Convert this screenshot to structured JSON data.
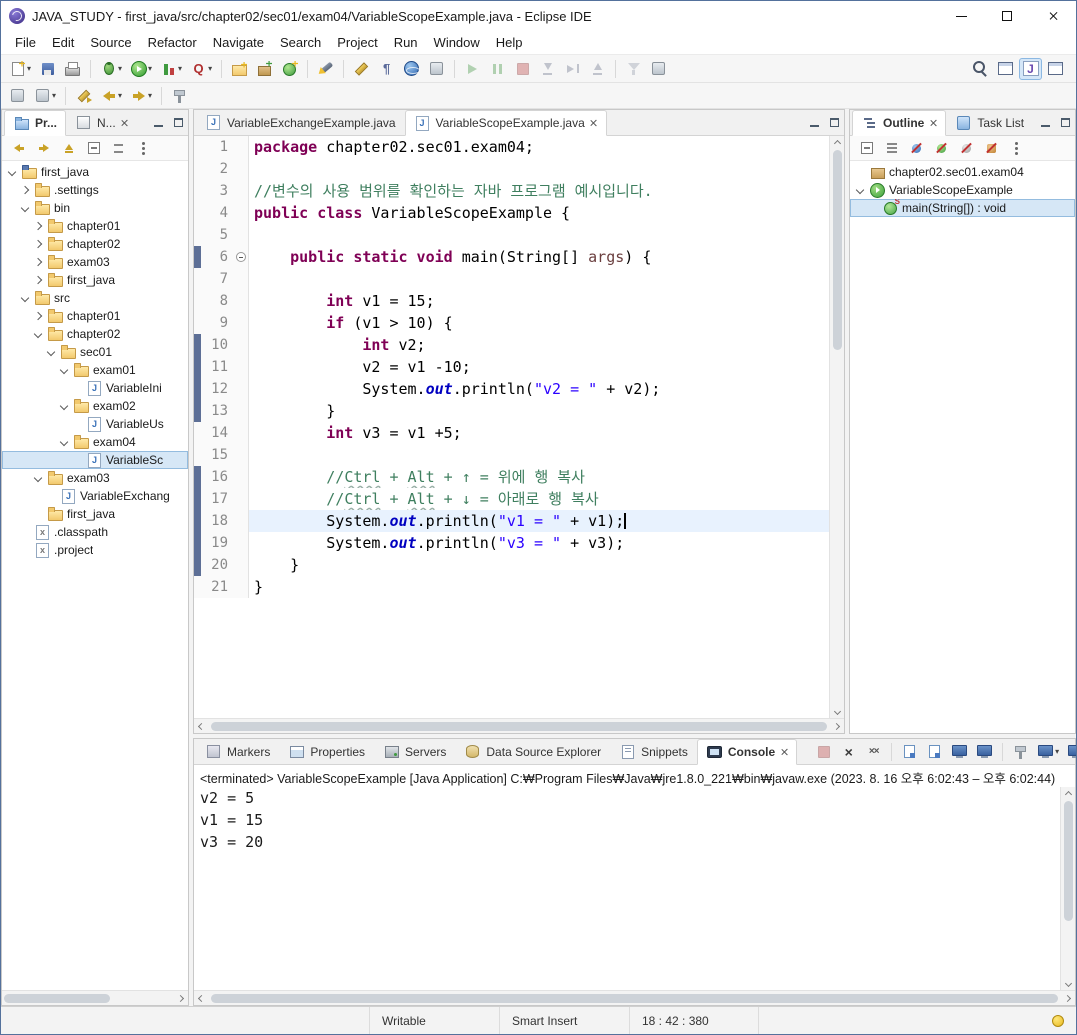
{
  "window": {
    "title": "JAVA_STUDY - first_java/src/chapter02/sec01/exam04/VariableScopeExample.java - Eclipse IDE"
  },
  "menubar": {
    "items": [
      "File",
      "Edit",
      "Source",
      "Refactor",
      "Navigate",
      "Search",
      "Project",
      "Run",
      "Window",
      "Help"
    ]
  },
  "toolbar": {
    "main": [
      {
        "name": "new-wizard",
        "icon": "new",
        "dd": true
      },
      {
        "name": "save",
        "icon": "save"
      },
      {
        "name": "print",
        "icon": "print"
      },
      {
        "sep": true
      },
      {
        "name": "debug",
        "icon": "debug",
        "dd": true
      },
      {
        "name": "run",
        "icon": "run",
        "dd": true
      },
      {
        "name": "coverage",
        "icon": "coverage",
        "dd": true
      },
      {
        "name": "external-tools",
        "icon": "qtool",
        "dd": true
      },
      {
        "sep": true
      },
      {
        "name": "new-java-project",
        "icon": "newprj"
      },
      {
        "name": "new-java-package",
        "icon": "newpkg"
      },
      {
        "name": "new-java-class",
        "icon": "newcls"
      },
      {
        "sep": true
      },
      {
        "name": "search",
        "icon": "flashlight"
      },
      {
        "sep": true
      },
      {
        "name": "mark-occurrences",
        "icon": "pencil"
      },
      {
        "name": "show-whitespace",
        "icon": "para"
      },
      {
        "name": "open-web-browser",
        "icon": "globe"
      },
      {
        "name": "open-task",
        "icon": "gen"
      },
      {
        "sep": true
      },
      {
        "name": "resume",
        "icon": "resume",
        "disabled": true
      },
      {
        "name": "suspend",
        "icon": "suspend",
        "disabled": true
      },
      {
        "name": "terminate",
        "icon": "terminate",
        "disabled": true
      },
      {
        "name": "step-into",
        "icon": "stepin",
        "disabled": true
      },
      {
        "name": "step-over",
        "icon": "stepover",
        "disabled": true
      },
      {
        "name": "step-return",
        "icon": "stepret",
        "disabled": true
      },
      {
        "sep": true
      },
      {
        "name": "use-step-filters",
        "icon": "filter",
        "disabled": true
      },
      {
        "name": "run-configurations",
        "icon": "gen"
      }
    ],
    "right": [
      {
        "name": "quick-access-search",
        "icon": "magnifier"
      },
      {
        "name": "open-perspective",
        "icon": "perspective"
      },
      {
        "name": "java-perspective",
        "icon": "javapersp",
        "active": true
      },
      {
        "name": "debug-perspective",
        "icon": "perspective"
      }
    ],
    "second": [
      {
        "name": "toggle-breadcrumb",
        "icon": "gen"
      },
      {
        "name": "annotations",
        "icon": "gen",
        "dd": true
      },
      {
        "sep": true
      },
      {
        "name": "last-edit-location",
        "icon": "lastedit"
      },
      {
        "name": "back-history",
        "icon": "backarrow",
        "dd": true
      },
      {
        "name": "forward-history",
        "icon": "fwdarrow",
        "dd": true
      },
      {
        "sep": true
      },
      {
        "name": "pin-editor",
        "icon": "pin"
      }
    ]
  },
  "explorer": {
    "tabs": [
      {
        "label": "Pr...",
        "icon": "prexp",
        "active": true
      },
      {
        "label": "N...",
        "icon": "nav",
        "close": true
      }
    ],
    "toolbar": [
      {
        "name": "back",
        "icon": "backsm"
      },
      {
        "name": "forward",
        "icon": "fwdsm"
      },
      {
        "name": "up",
        "icon": "upsm"
      },
      {
        "name": "collapse-all",
        "icon": "collapse"
      },
      {
        "name": "link-with-editor",
        "icon": "link"
      },
      {
        "name": "view-menu",
        "icon": "dots"
      }
    ],
    "tree": [
      {
        "label": "first_java",
        "level": 0,
        "icon": "project",
        "arrow": "v"
      },
      {
        "label": ".settings",
        "level": 1,
        "icon": "folder",
        "arrow": ">"
      },
      {
        "label": "bin",
        "level": 1,
        "icon": "folder",
        "arrow": "v"
      },
      {
        "label": "chapter01",
        "level": 2,
        "icon": "folder",
        "arrow": ">"
      },
      {
        "label": "chapter02",
        "level": 2,
        "icon": "folder",
        "arrow": ">"
      },
      {
        "label": "exam03",
        "level": 2,
        "icon": "folder",
        "arrow": ">"
      },
      {
        "label": "first_java",
        "level": 2,
        "icon": "folder",
        "arrow": ">"
      },
      {
        "label": "src",
        "level": 1,
        "icon": "folder",
        "arrow": "v"
      },
      {
        "label": "chapter01",
        "level": 2,
        "icon": "folder",
        "arrow": ">"
      },
      {
        "label": "chapter02",
        "level": 2,
        "icon": "folder",
        "arrow": "v"
      },
      {
        "label": "sec01",
        "level": 3,
        "icon": "folder",
        "arrow": "v"
      },
      {
        "label": "exam01",
        "level": 4,
        "icon": "folder",
        "arrow": "v"
      },
      {
        "label": "VariableIni",
        "level": 5,
        "icon": "jfile",
        "arrow": ""
      },
      {
        "label": "exam02",
        "level": 4,
        "icon": "folder",
        "arrow": "v"
      },
      {
        "label": "VariableUs",
        "level": 5,
        "icon": "jfile",
        "arrow": ""
      },
      {
        "label": "exam04",
        "level": 4,
        "icon": "folder",
        "arrow": "v"
      },
      {
        "label": "VariableSc",
        "level": 5,
        "icon": "jfile",
        "arrow": "",
        "selected": true
      },
      {
        "label": "exam03",
        "level": 2,
        "icon": "folder",
        "arrow": "v"
      },
      {
        "label": "VariableExchang",
        "level": 3,
        "icon": "jfile",
        "arrow": ""
      },
      {
        "label": "first_java",
        "level": 2,
        "icon": "folder",
        "arrow": ""
      },
      {
        "label": ".classpath",
        "level": 1,
        "icon": "xfile",
        "arrow": ""
      },
      {
        "label": ".project",
        "level": 1,
        "icon": "xfile",
        "arrow": ""
      }
    ]
  },
  "editor": {
    "tabs": [
      {
        "label": "VariableExchangeExample.java",
        "icon": "jfile"
      },
      {
        "label": "VariableScopeExample.java",
        "icon": "jfile",
        "active": true,
        "close": true
      }
    ],
    "current_line": 18,
    "fold_line": 6,
    "change_bars": [
      [
        6,
        6
      ],
      [
        10,
        13
      ],
      [
        16,
        20
      ]
    ],
    "colors": {
      "keyword": "#7f0055",
      "string": "#2a00ff",
      "comment": "#3f7f5f",
      "static_field": "#0000c0",
      "current_line": "#e8f2fe",
      "change_bar": "#5d6f96",
      "selection": "#d6e7f6"
    },
    "lines": [
      {
        "n": 1,
        "segs": [
          [
            "kw",
            "package"
          ],
          [
            "pl",
            " chapter02.sec01.exam04;"
          ]
        ]
      },
      {
        "n": 2
      },
      {
        "n": 3,
        "segs": [
          [
            "com",
            "//변수의 사용 범위를 확인하는 자바 프로그램 예시입니다."
          ]
        ]
      },
      {
        "n": 4,
        "segs": [
          [
            "kw",
            "public class"
          ],
          [
            "pl",
            " VariableScopeExample {"
          ]
        ]
      },
      {
        "n": 5
      },
      {
        "n": 6,
        "segs": [
          [
            "pl",
            "    "
          ],
          [
            "kw",
            "public static void"
          ],
          [
            "pl",
            " main(String[] "
          ],
          [
            "param",
            "args"
          ],
          [
            "pl",
            ") {"
          ]
        ]
      },
      {
        "n": 7
      },
      {
        "n": 8,
        "segs": [
          [
            "pl",
            "        "
          ],
          [
            "kw",
            "int"
          ],
          [
            "pl",
            " v1 = 15;"
          ]
        ]
      },
      {
        "n": 9,
        "segs": [
          [
            "pl",
            "        "
          ],
          [
            "kw",
            "if"
          ],
          [
            "pl",
            " (v1 > 10) {"
          ]
        ]
      },
      {
        "n": 10,
        "segs": [
          [
            "pl",
            "            "
          ],
          [
            "kw",
            "int"
          ],
          [
            "pl",
            " v2;"
          ]
        ]
      },
      {
        "n": 11,
        "segs": [
          [
            "pl",
            "            v2 = v1 -10;"
          ]
        ]
      },
      {
        "n": 12,
        "segs": [
          [
            "pl",
            "            System."
          ],
          [
            "field",
            "out"
          ],
          [
            "pl",
            ".println("
          ],
          [
            "str",
            "\"v2 = \""
          ],
          [
            "pl",
            " + v2);"
          ]
        ]
      },
      {
        "n": 13,
        "segs": [
          [
            "pl",
            "        }"
          ]
        ]
      },
      {
        "n": 14,
        "segs": [
          [
            "pl",
            "        "
          ],
          [
            "kw",
            "int"
          ],
          [
            "pl",
            " v3 = v1 +5;"
          ]
        ]
      },
      {
        "n": 15
      },
      {
        "n": 16,
        "segs": [
          [
            "com",
            "        //"
          ],
          [
            "comu",
            "Ctrl"
          ],
          [
            "com",
            " + "
          ],
          [
            "comu",
            "Alt"
          ],
          [
            "com",
            " + ↑ = 위에 행 복사"
          ]
        ]
      },
      {
        "n": 17,
        "segs": [
          [
            "com",
            "        //"
          ],
          [
            "comu",
            "Ctrl"
          ],
          [
            "com",
            " + "
          ],
          [
            "comu",
            "Alt"
          ],
          [
            "com",
            " + ↓ = 아래로 행 복사"
          ]
        ]
      },
      {
        "n": 18,
        "caret": true,
        "segs": [
          [
            "pl",
            "        System."
          ],
          [
            "field",
            "out"
          ],
          [
            "pl",
            ".println("
          ],
          [
            "str",
            "\"v1 = \""
          ],
          [
            "pl",
            " + v1);"
          ]
        ]
      },
      {
        "n": 19,
        "segs": [
          [
            "pl",
            "        System."
          ],
          [
            "field",
            "out"
          ],
          [
            "pl",
            ".println("
          ],
          [
            "str",
            "\"v3 = \""
          ],
          [
            "pl",
            " + v3);"
          ]
        ]
      },
      {
        "n": 20,
        "segs": [
          [
            "pl",
            "    }"
          ]
        ]
      },
      {
        "n": 21,
        "segs": [
          [
            "pl",
            "}"
          ]
        ]
      }
    ]
  },
  "outline": {
    "tabs": [
      {
        "label": "Outline",
        "icon": "outline",
        "active": true,
        "close": true
      },
      {
        "label": "Task List",
        "icon": "tasklist"
      }
    ],
    "toolbar": [
      {
        "name": "collapse-all",
        "icon": "collapse"
      },
      {
        "name": "sort",
        "icon": "sort"
      },
      {
        "name": "hide-fields",
        "icon": "hidefields"
      },
      {
        "name": "hide-static-members",
        "icon": "hidestatic"
      },
      {
        "name": "hide-non-public-members",
        "icon": "hidenonpublic"
      },
      {
        "name": "hide-local-types",
        "icon": "hidelocal"
      },
      {
        "name": "view-menu",
        "icon": "dots"
      }
    ],
    "tree": [
      {
        "label": "chapter02.sec01.exam04",
        "level": 0,
        "icon": "pkg",
        "arrow": ""
      },
      {
        "label": "VariableScopeExample",
        "level": 0,
        "icon": "classrun",
        "arrow": "v"
      },
      {
        "label": "main(String[]) : void",
        "level": 1,
        "icon": "method",
        "arrow": "",
        "selected": true
      }
    ]
  },
  "console": {
    "tabs": [
      {
        "label": "Markers",
        "icon": "markers"
      },
      {
        "label": "Properties",
        "icon": "properties"
      },
      {
        "label": "Servers",
        "icon": "servers"
      },
      {
        "label": "Data Source Explorer",
        "icon": "dse"
      },
      {
        "label": "Snippets",
        "icon": "snippets"
      },
      {
        "label": "Console",
        "icon": "consoletab",
        "active": true,
        "close": true
      }
    ],
    "actions": [
      {
        "name": "terminate",
        "icon": "terminate",
        "disabled": true
      },
      {
        "name": "remove-launch",
        "icon": "xgray"
      },
      {
        "name": "remove-all-terminated",
        "icon": "xxgray"
      },
      {
        "sep": true
      },
      {
        "name": "clear-console",
        "icon": "bluedoc"
      },
      {
        "name": "scroll-lock",
        "icon": "bluedoc"
      },
      {
        "name": "word-wrap",
        "icon": "bluemon"
      },
      {
        "name": "show-on-output",
        "icon": "bluemon"
      },
      {
        "sep": true
      },
      {
        "name": "pin-console",
        "icon": "pin"
      },
      {
        "name": "display-selected-console",
        "icon": "bluemon",
        "dd": true
      },
      {
        "name": "open-console",
        "icon": "bluemon",
        "dd": true
      }
    ],
    "header": "<terminated> VariableScopeExample [Java Application] C:₩Program Files₩Java₩jre1.8.0_221₩bin₩javaw.exe  (2023. 8. 16 오후 6:02:43 – 오후 6:02:44)",
    "output": [
      "v2 = 5",
      "v1 = 15",
      "v3 = 20"
    ]
  },
  "statusbar": {
    "writable": "Writable",
    "smart_insert": "Smart Insert",
    "caret_position": "18 : 42 : 380"
  }
}
